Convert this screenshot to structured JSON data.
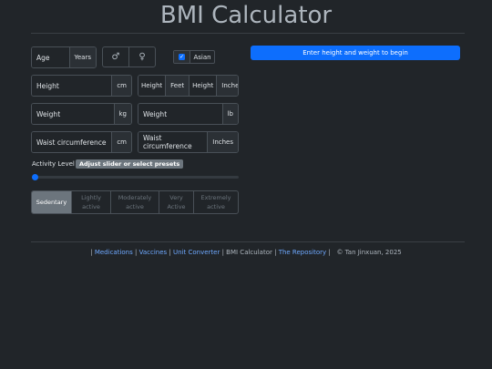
{
  "title": "BMI Calculator",
  "inputs": {
    "age": {
      "placeholder": "Age",
      "unit": "Years"
    },
    "sex": {
      "male_icon": "♂",
      "female_icon": "♀"
    },
    "asian": {
      "label": "Asian",
      "checked": true,
      "check_glyph": "✓"
    },
    "height_cm": {
      "placeholder": "Height",
      "unit": "cm"
    },
    "height_ft": {
      "label": "Height",
      "unit": "Feet"
    },
    "height_in": {
      "label": "Height",
      "unit": "Inches"
    },
    "weight_kg": {
      "placeholder": "Weight",
      "unit": "kg"
    },
    "weight_lb": {
      "placeholder": "Weight",
      "unit": "lb"
    },
    "waist_cm": {
      "placeholder": "Waist circumference",
      "unit": "cm"
    },
    "waist_in": {
      "placeholder": "Waist circumference",
      "unit": "Inches"
    }
  },
  "result_button": "Enter height and weight to begin",
  "activity": {
    "label": "Activity Level",
    "badge": "Adjust slider or select presets",
    "slider_value": 0,
    "presets": [
      {
        "line1": "Sedentary",
        "line2": ""
      },
      {
        "line1": "Lightly",
        "line2": "active"
      },
      {
        "line1": "Moderately",
        "line2": "active"
      },
      {
        "line1": "Very",
        "line2": "Active"
      },
      {
        "line1": "Extremely",
        "line2": "active"
      }
    ],
    "selected": "Sedentary"
  },
  "footer": {
    "lead": "|",
    "links": [
      "Medications",
      "Vaccines",
      "Unit Converter"
    ],
    "current": "BMI Calculator",
    "repo": "The Repository",
    "copyright": "© Tan Jinxuan, 2025"
  },
  "colors": {
    "accent": "#0d6efd",
    "background": "#212529",
    "link": "#6ea8fe"
  }
}
